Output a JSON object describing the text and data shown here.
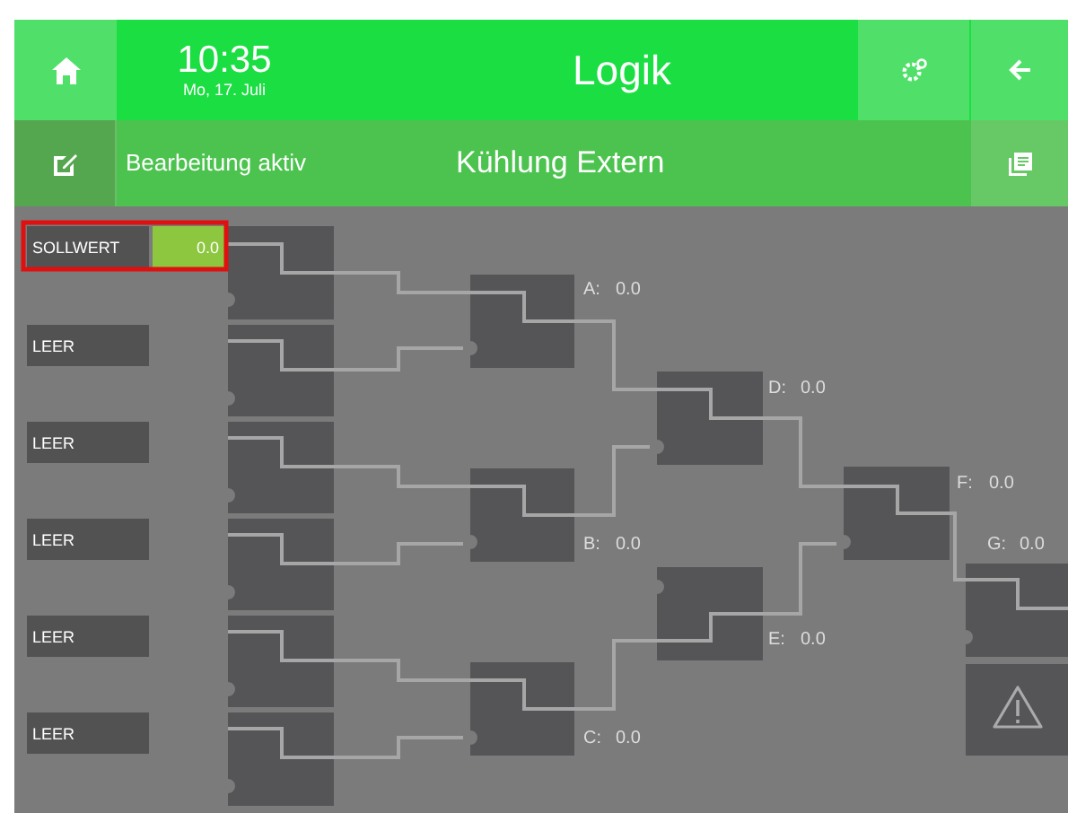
{
  "header": {
    "time": "10:35",
    "date": "Mo, 17. Juli",
    "title": "Logik"
  },
  "subheader": {
    "status": "Bearbeitung aktiv",
    "title": "Kühlung Extern"
  },
  "inputs": [
    {
      "label": "SOLLWERT",
      "value": "0.0",
      "selected": true
    },
    {
      "label": "LEER",
      "selected": false
    },
    {
      "label": "LEER",
      "selected": false
    },
    {
      "label": "LEER",
      "selected": false
    },
    {
      "label": "LEER",
      "selected": false
    },
    {
      "label": "LEER",
      "selected": false
    }
  ],
  "outputs": [
    {
      "name": "A:",
      "value": "0.0"
    },
    {
      "name": "B:",
      "value": "0.0"
    },
    {
      "name": "C:",
      "value": "0.0"
    },
    {
      "name": "D:",
      "value": "0.0"
    },
    {
      "name": "E:",
      "value": "0.0"
    },
    {
      "name": "F:",
      "value": "0.0"
    },
    {
      "name": "G:",
      "value": "0.0"
    }
  ]
}
